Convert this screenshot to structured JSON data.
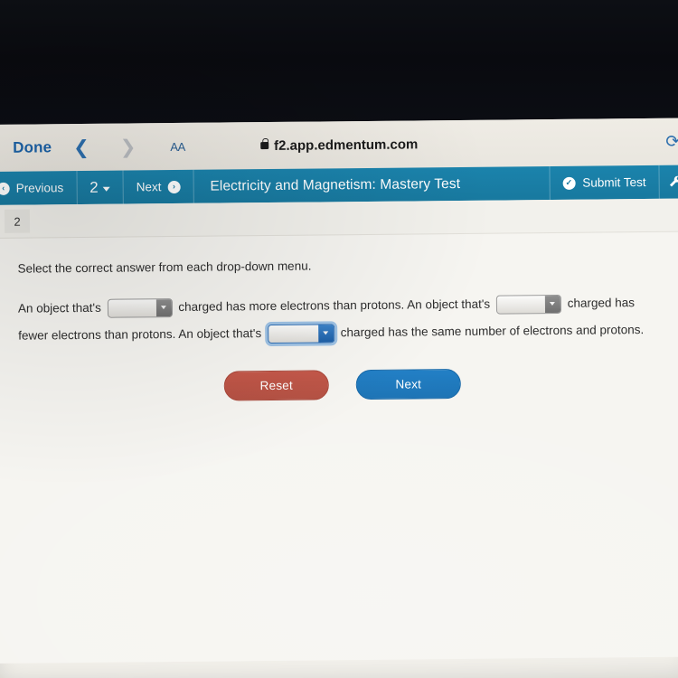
{
  "browser": {
    "done_label": "Done",
    "back_icon": "chevron-left-icon",
    "forward_icon": "chevron-right-icon",
    "text_size_label": "AA",
    "url": "f2.app.edmentum.com",
    "lock_icon": "lock-icon",
    "reload_icon": "reload-icon",
    "reload_glyph": "⟳"
  },
  "toolbar": {
    "previous_label": "Previous",
    "previous_icon": "arrow-left-circle-icon",
    "previous_glyph": "‹",
    "question_number": "2",
    "question_dropdown_icon": "chevron-down-icon",
    "next_label": "Next",
    "next_icon": "arrow-right-circle-icon",
    "next_glyph": "›",
    "title": "Electricity and Magnetism: Mastery Test",
    "submit_label": "Submit Test",
    "submit_icon": "check-circle-icon",
    "submit_glyph": "✓",
    "tools_icon": "wrench-icon",
    "tools_glyph": "🔧",
    "accent_color": "#1b83ac"
  },
  "question": {
    "number_tab": "2",
    "instruction": "Select the correct answer from each drop-down menu.",
    "sentence": {
      "part1": "An object that's",
      "part2": "charged has more electrons than protons. An object that's",
      "part3": "charged has fewer electrons than protons. An object that's",
      "part4": "charged has the same number of electrons and protons."
    },
    "dropdowns": [
      {
        "name": "dropdown-1",
        "value": "",
        "focused": false
      },
      {
        "name": "dropdown-2",
        "value": "",
        "focused": false
      },
      {
        "name": "dropdown-3",
        "value": "",
        "focused": true
      }
    ]
  },
  "actions": {
    "reset_label": "Reset",
    "reset_color": "#c4584a",
    "next_label": "Next",
    "next_color": "#2380c6"
  }
}
